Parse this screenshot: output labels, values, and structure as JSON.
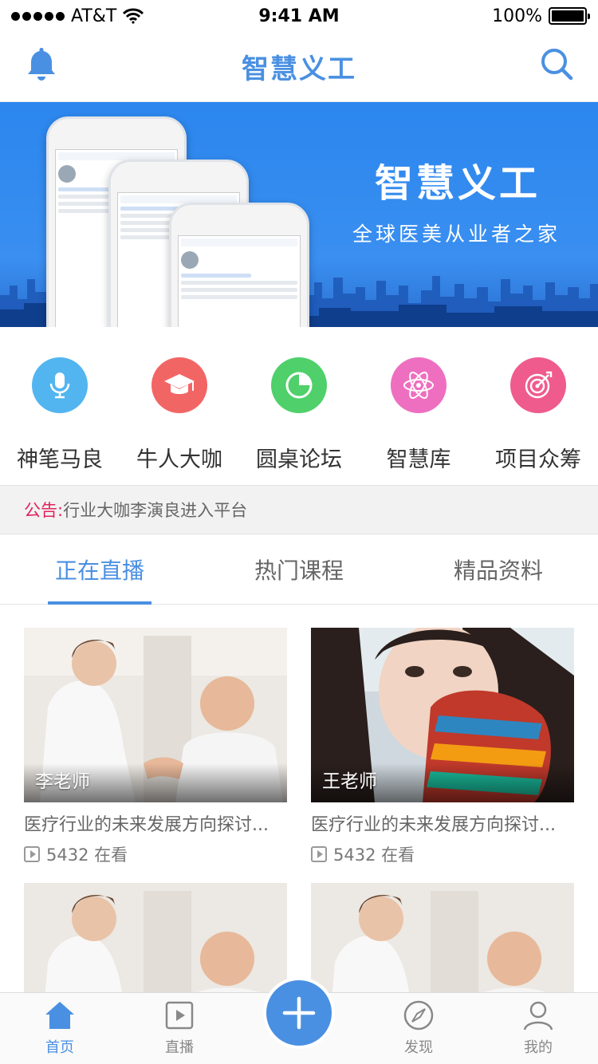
{
  "status_bar": {
    "carrier": "AT&T",
    "time": "9:41 AM",
    "battery": "100%"
  },
  "header": {
    "title": "智慧义工"
  },
  "banner": {
    "title": "智慧义工",
    "subtitle": "全球医美从业者之家"
  },
  "categories": [
    {
      "label": "神笔马良",
      "icon": "microphone-icon",
      "color": "#52b5f0"
    },
    {
      "label": "牛人大咖",
      "icon": "graduation-cap-icon",
      "color": "#f26565"
    },
    {
      "label": "圆桌论坛",
      "icon": "pie-chart-icon",
      "color": "#4fd06a"
    },
    {
      "label": "智慧库",
      "icon": "atom-icon",
      "color": "#ee6fc0"
    },
    {
      "label": "项目众筹",
      "icon": "target-icon",
      "color": "#ef5b8c"
    }
  ],
  "notice": {
    "label": "公告:",
    "text": "行业大咖李演良进入平台"
  },
  "tabs": [
    {
      "label": "正在直播",
      "active": true
    },
    {
      "label": "热门课程",
      "active": false
    },
    {
      "label": "精品资料",
      "active": false
    }
  ],
  "cards": [
    {
      "teacher": "李老师",
      "title": "医疗行业的未来发展方向探讨...",
      "viewers": "5432 在看"
    },
    {
      "teacher": "王老师",
      "title": "医疗行业的未来发展方向探讨...",
      "viewers": "5432 在看"
    },
    {
      "teacher": "",
      "title": "",
      "viewers": ""
    },
    {
      "teacher": "",
      "title": "",
      "viewers": ""
    }
  ],
  "bottom_nav": {
    "home": "首页",
    "live": "直播",
    "discover": "发现",
    "mine": "我的"
  },
  "colors": {
    "accent": "#4a90e2",
    "notice_label": "#e0245e"
  }
}
